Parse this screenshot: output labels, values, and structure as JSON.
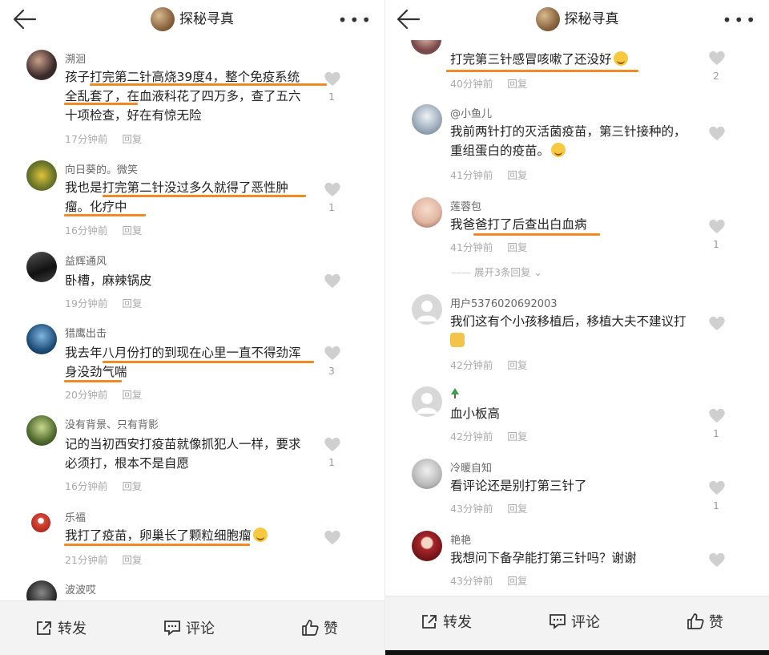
{
  "topbar": {
    "title": "探秘寻真"
  },
  "left_comments": [
    {
      "user": "溯洄",
      "lines": [
        "孩子打完第二针高烧39度4，整个免疫系统",
        "全乱套了，在血液科花了四万多，查了五六",
        "十项检查，好在有惊无险"
      ],
      "time": "17分钟前",
      "reply": "回复",
      "likes": "1",
      "avatar": "#3a2a2a"
    },
    {
      "user": "向日葵的。微笑",
      "lines": [
        "我也是打完第二针没过多久就得了恶性肿",
        "瘤。化疗中"
      ],
      "time": "16分钟前",
      "reply": "回复",
      "likes": "1",
      "avatar": "#6f7a2a"
    },
    {
      "user": "益辉通风",
      "lines": [
        "卧槽，麻辣锅皮"
      ],
      "time": "19分钟前",
      "reply": "回复",
      "likes": "",
      "avatar": "#222222"
    },
    {
      "user": "猎鹰出击",
      "lines": [
        "我去年八月份打的到现在心里一直不得劲浑",
        "身没劲气喘"
      ],
      "time": "20分钟前",
      "reply": "回复",
      "likes": "3",
      "avatar": "#1f4f7a"
    },
    {
      "user": "没有背景、只有背影",
      "lines": [
        "记的当初西安打疫苗就像抓犯人一样，要求",
        "必须打，根本不是自愿"
      ],
      "time": "16分钟前",
      "reply": "回复",
      "likes": "1",
      "avatar": "#4f6a2f"
    },
    {
      "user": "乐福",
      "lines": [
        "我打了疫苗，卵巢长了颗粒细胞瘤"
      ],
      "time": "21分钟前",
      "reply": "回复",
      "likes": "",
      "avatar": "#d94a3a"
    },
    {
      "user": "波波哎",
      "lines": [],
      "time": "",
      "reply": "",
      "likes": "",
      "avatar": "#3a3a3a"
    }
  ],
  "right_comments": [
    {
      "user": "",
      "lines": [
        "打完第三针感冒咳嗽了还没好"
      ],
      "time": "40分钟前",
      "reply": "回复",
      "likes": "2",
      "avatar": "#7a4a4a"
    },
    {
      "user": "@小鱼儿",
      "lines": [
        "我前两针打的灭活菌疫苗，第三针接种的，",
        "重组蛋白的疫苗。"
      ],
      "time": "41分钟前",
      "reply": "回复",
      "likes": "",
      "avatar": "#9aa9b8"
    },
    {
      "user": "莲蓉包",
      "lines": [
        "我爸爸打了后查出白血病"
      ],
      "time": "41分钟前",
      "reply": "回复",
      "likes": "1",
      "avatar": "#e2b7a3"
    },
    {
      "user": "用户5376020692003",
      "lines": [
        "我们这有个小孩移植后，移植大夫不建议打"
      ],
      "time": "42分钟前",
      "reply": "回复",
      "likes": "",
      "avatar": "#cfcfcf"
    },
    {
      "user": "",
      "lines": [
        "血小板高"
      ],
      "time": "42分钟前",
      "reply": "回复",
      "likes": "1",
      "avatar": "#cfcfcf"
    },
    {
      "user": "冷暖自知",
      "lines": [
        "看评论还是别打第三针了"
      ],
      "time": "43分钟前",
      "reply": "回复",
      "likes": "1",
      "avatar": "#b9b9b9"
    },
    {
      "user": "艳艳",
      "lines": [
        "我想问下备孕能打第三针吗？谢谢"
      ],
      "time": "43分钟前",
      "reply": "回复",
      "likes": "",
      "avatar": "#a8262a"
    }
  ],
  "expand_text": "展开3条回复",
  "bottom": {
    "share": "转发",
    "comment": "评论",
    "like": "赞"
  },
  "accent": "#f08a24"
}
